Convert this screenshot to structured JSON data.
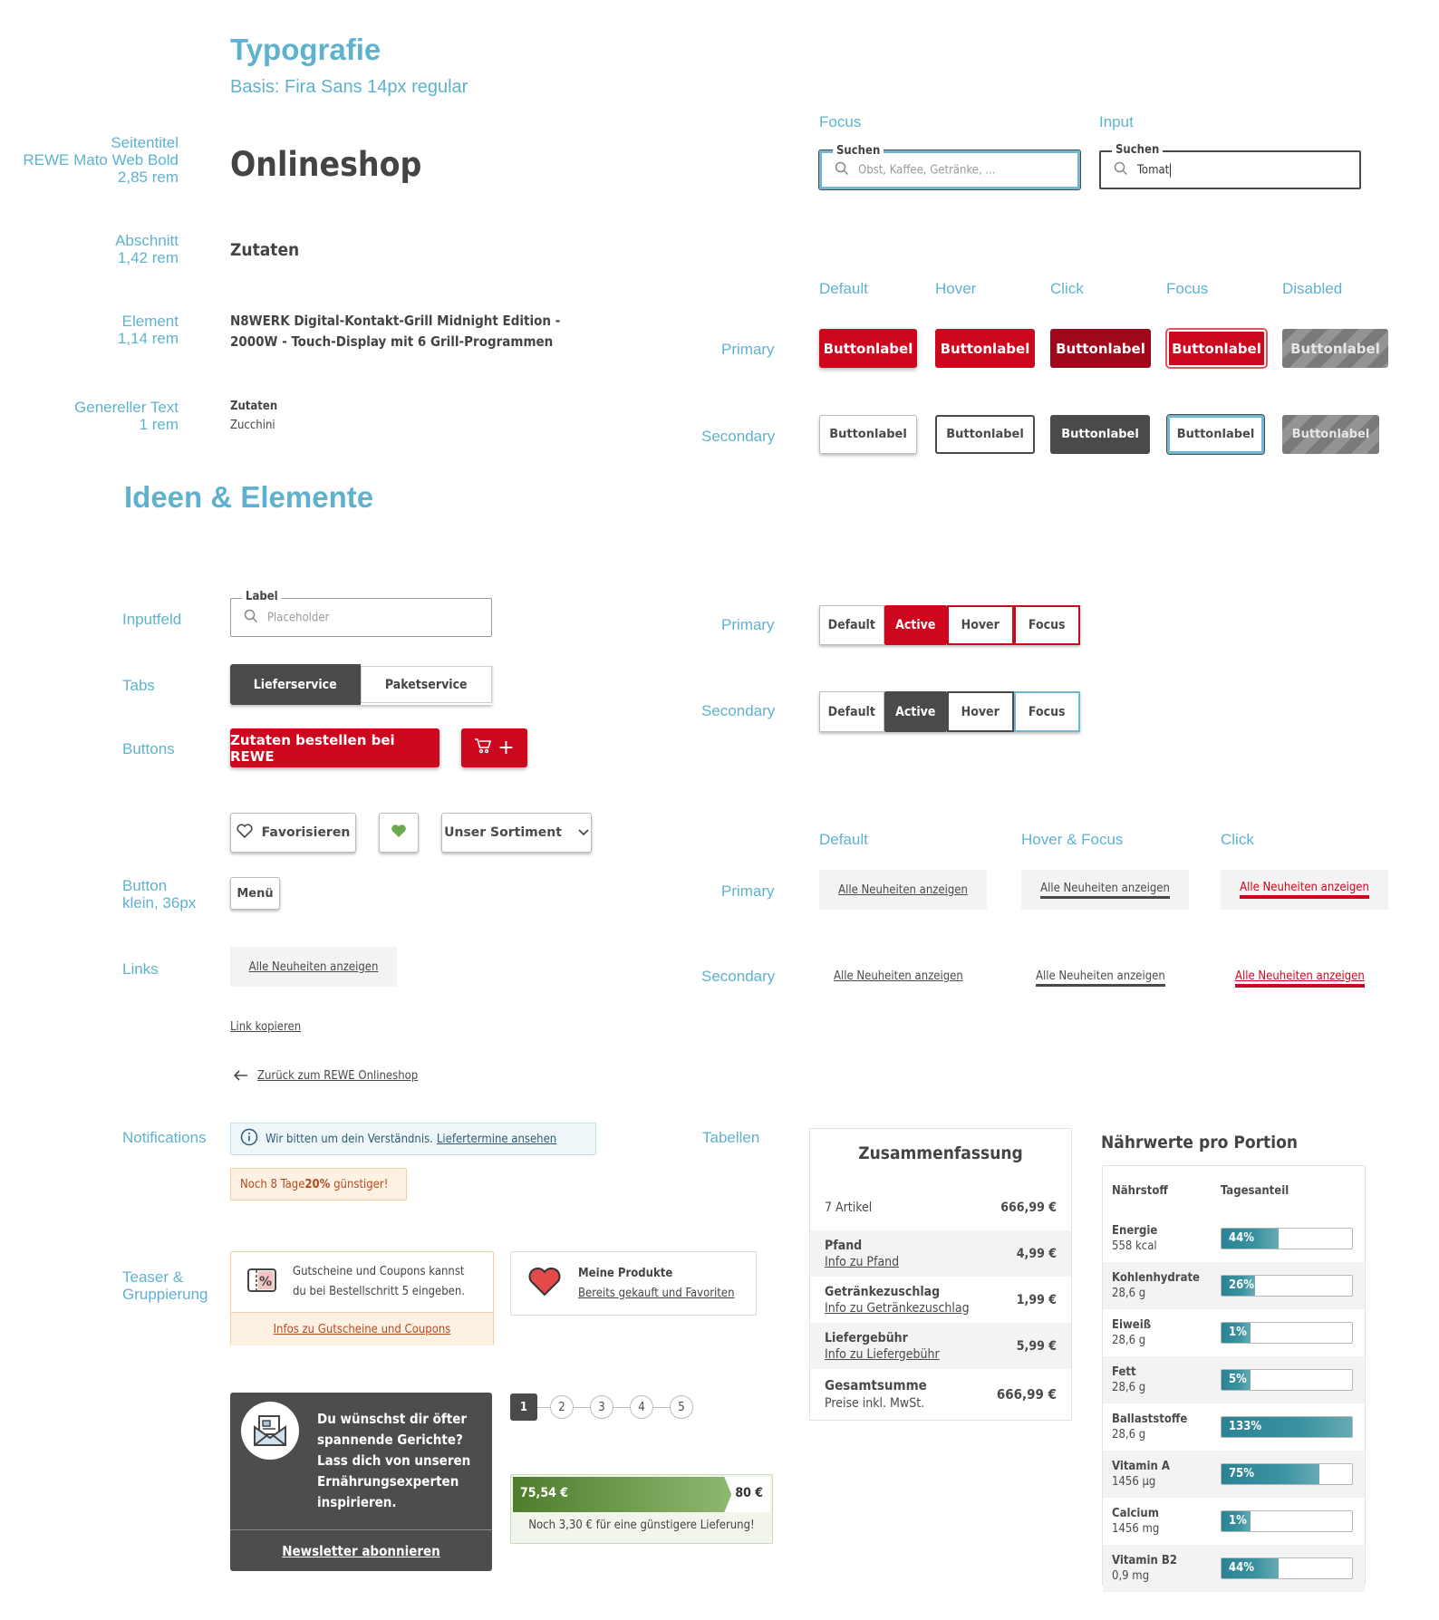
{
  "typography": {
    "title": "Typografie",
    "subtitle": "Basis: Fira Sans 14px regular",
    "rows": [
      {
        "label": [
          "Seitentitel",
          "REWE Mato Web Bold",
          "2,85 rem"
        ],
        "sample": "Onlineshop"
      },
      {
        "label": [
          "Abschnitt",
          "1,42 rem"
        ],
        "sample": "Zutaten"
      },
      {
        "label": [
          "Element",
          "1,14 rem"
        ],
        "sample": [
          "N8WERK Digital-Kontakt-Grill Midnight Edition -",
          "2000W - Touch-Display mit 6 Grill-Programmen"
        ]
      },
      {
        "label": [
          "Genereller Text",
          "1 rem"
        ],
        "sample": [
          "Zutaten",
          "Zucchini"
        ]
      }
    ]
  },
  "search_states": {
    "focus": {
      "state": "Focus",
      "label": "Suchen",
      "placeholder": "Obst, Kaffee, Getränke, ..."
    },
    "input": {
      "state": "Input",
      "label": "Suchen",
      "value": "Tomat"
    }
  },
  "button_states": {
    "headers": [
      "Default",
      "Hover",
      "Click",
      "Focus",
      "Disabled"
    ],
    "primary_label": "Primary",
    "secondary_label": "Secondary",
    "button_label": "Buttonlabel"
  },
  "ideas": {
    "title": "Ideen & Elemente",
    "sections": {
      "inputfeld": "Inputfeld",
      "tabs": "Tabs",
      "buttons": "Buttons",
      "button_small": [
        "Button",
        "klein, 36px"
      ],
      "links": "Links",
      "notifications": "Notifications",
      "teaser": [
        "Teaser &",
        "Gruppierung"
      ],
      "tables": "Tabellen"
    },
    "input": {
      "label": "Label",
      "placeholder": "Placeholder"
    },
    "tabs": [
      {
        "label": "Lieferservice",
        "active": true
      },
      {
        "label": "Paketservice",
        "active": false
      }
    ],
    "order_button": "Zutaten bestellen bei REWE",
    "cart_plus": "+",
    "favorite_button": "Favorisieren",
    "sortiment_button": "Unser Sortiment",
    "menu_button": "Menü",
    "link_box": "Alle Neuheiten anzeigen",
    "link_copy": "Link kopieren",
    "back_link": "Zurück zum REWE Onlineshop",
    "info_notification": {
      "text": "Wir bitten um dein Verständnis.",
      "link": "Liefertermine ansehen"
    },
    "promo_notification": {
      "pre": "Noch 8 Tage ",
      "bold": "20%",
      "post": " günstiger!"
    },
    "coupon_teaser": {
      "text": [
        "Gutscheine und Coupons kannst",
        "du bei Bestellschritt 5 eingeben."
      ],
      "link": "Infos zu Gutscheine und Coupons"
    },
    "products_teaser": {
      "title": "Meine Produkte",
      "link": "Bereits gekauft und Favoriten"
    },
    "newsletter": {
      "text": [
        "Du wünschst dir öfter",
        "spannende Gerichte?",
        "Lass dich von unseren",
        "Ernährungsexperten",
        "inspirieren."
      ],
      "link": "Newsletter abonnieren"
    },
    "stepper": {
      "steps": [
        "1",
        "2",
        "3",
        "4",
        "5"
      ],
      "current": 1
    },
    "delivery_progress": {
      "current": "75,54 €",
      "target": "80 €",
      "progress": 0.944,
      "hint": "Noch 3,30 € für eine günstigere Lieferung!"
    }
  },
  "tab_states": {
    "primary_label": "Primary",
    "secondary_label": "Secondary",
    "items": [
      "Default",
      "Active",
      "Hover",
      "Focus"
    ]
  },
  "link_states": {
    "headers": [
      "Default",
      "Hover & Focus",
      "Click"
    ],
    "primary_label": "Primary",
    "secondary_label": "Secondary",
    "link_label": "Alle Neuheiten anzeigen"
  },
  "summary": {
    "title": "Zusammenfassung",
    "rows": [
      {
        "name": "7 Artikel",
        "info": "",
        "value": "666,99 €"
      },
      {
        "name": "Pfand",
        "info": "Info zu Pfand",
        "value": "4,99 €"
      },
      {
        "name": "Getränkezuschlag",
        "info": "Info zu Getränkezuschlag",
        "value": "1,99 €"
      },
      {
        "name": "Liefergebühr",
        "info": "Info zu Liefergebühr",
        "value": "5,99 €"
      }
    ],
    "total": {
      "name": "Gesamtsumme",
      "note": "Preise inkl. MwSt.",
      "value": "666,99 €"
    }
  },
  "nutrition": {
    "title": "Nährwerte pro Portion",
    "headers": [
      "Nährstoff",
      "Tagesanteil"
    ],
    "rows": [
      {
        "name": "Energie",
        "amount": "558 kcal",
        "percent": 44
      },
      {
        "name": "Kohlenhydrate",
        "amount": "28,6 g",
        "percent": 26
      },
      {
        "name": "Eiweiß",
        "amount": "28,6 g",
        "percent": 1
      },
      {
        "name": "Fett",
        "amount": "28,6 g",
        "percent": 5
      },
      {
        "name": "Ballaststoffe",
        "amount": "28,6 g",
        "percent": 133
      },
      {
        "name": "Vitamin A",
        "amount": "1456 µg",
        "percent": 75
      },
      {
        "name": "Calcium",
        "amount": "1456 mg",
        "percent": 1
      },
      {
        "name": "Vitamin B2",
        "amount": "0,9 mg",
        "percent": 44
      }
    ]
  },
  "colors": {
    "accent_blue": "#5fb2cf",
    "rewe_red": "#cc071e",
    "dark": "#4a4a4a",
    "teal_bar": "#2b8294",
    "green_progress": "#4e7d2c"
  }
}
